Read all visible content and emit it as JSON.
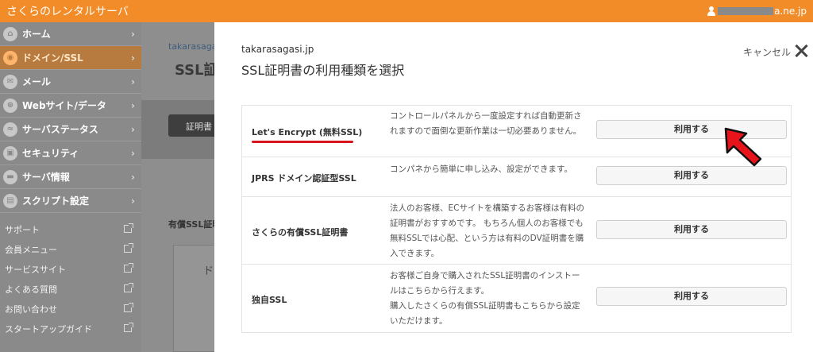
{
  "header": {
    "brand": "さくらのレンタルサーバ",
    "account_suffix": "a.ne.jp"
  },
  "sidebar": {
    "nav": [
      {
        "label": "ホーム",
        "icon": "home-icon",
        "glyph": "⌂"
      },
      {
        "label": "ドメイン/SSL",
        "icon": "domain-icon",
        "glyph": "◉",
        "active": true
      },
      {
        "label": "メール",
        "icon": "mail-icon",
        "glyph": "✉"
      },
      {
        "label": "Webサイト/データ",
        "icon": "web-icon",
        "glyph": "⊕"
      },
      {
        "label": "サーバステータス",
        "icon": "chart-icon",
        "glyph": "≈"
      },
      {
        "label": "セキュリティ",
        "icon": "lock-icon",
        "glyph": "▣"
      },
      {
        "label": "サーバ情報",
        "icon": "server-icon",
        "glyph": "▬"
      },
      {
        "label": "スクリプト設定",
        "icon": "script-icon",
        "glyph": "▤"
      }
    ],
    "links": [
      "サポート",
      "会員メニュー",
      "サービスサイト",
      "よくある質問",
      "お問い合わせ",
      "スタートアップガイド"
    ]
  },
  "background": {
    "domain": "takarasaga",
    "title": "SSL証",
    "button": "証明書",
    "section_label": "有償SSL証明",
    "card_text": "ド"
  },
  "modal": {
    "domain": "takarasagasi.jp",
    "title": "SSL証明書の利用種類を選択",
    "cancel_label": "キャンセル",
    "rows": [
      {
        "name": "Let's Encrypt (無料SSL)",
        "desc": "コントロールパネルから一度設定すれば自動更新されますので面倒な更新作業は一切必要ありません。",
        "button": "利用する"
      },
      {
        "name": "JPRS ドメイン認証型SSL",
        "desc": "コンパネから簡単に申し込み、設定ができます。",
        "button": "利用する"
      },
      {
        "name": "さくらの有償SSL証明書",
        "desc": "法人のお客様、ECサイトを構築するお客様は有料の証明書がおすすめです。 もちろん個人のお客様でも無料SSLでは心配、という方は有料のDV証明書を購入できます。",
        "button": "利用する"
      },
      {
        "name": "独自SSL",
        "desc": "お客様ご自身で購入されたSSL証明書のインストールはこちらから行えます。\n購入したさくらの有償SSL証明書もこちらから設定いただけます。",
        "button": "利用する"
      }
    ]
  },
  "colors": {
    "header": "#f28c28",
    "sidebar": "#8a8a8a",
    "active": "#b77a3f",
    "underline": "#d7141d",
    "arrow": "#e8141c"
  }
}
